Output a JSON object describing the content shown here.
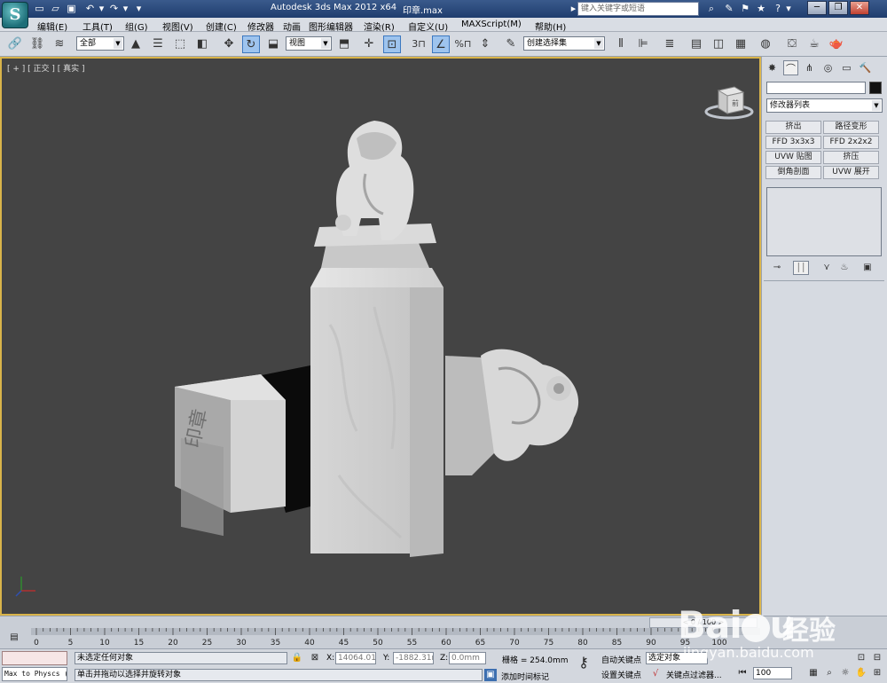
{
  "titlebar": {
    "logo": "S",
    "app_title": "Autodesk 3ds Max  2012 x64",
    "file_name": "印章.max",
    "search_placeholder": "键入关键字或短语",
    "window_buttons": [
      "─",
      "❐",
      "✕"
    ]
  },
  "menu": [
    "编辑(E)",
    "工具(T)",
    "组(G)",
    "视图(V)",
    "创建(C)",
    "修改器",
    "动画",
    "图形编辑器",
    "渲染(R)",
    "自定义(U)",
    "MAXScript(M)",
    "帮助(H)"
  ],
  "toolbar": {
    "selection_filter": "全部",
    "reference_coord": "视图",
    "named_selection": "创建选择集",
    "snap_label": "3",
    "percent_label": "%"
  },
  "viewport": {
    "label": "[ + ] [ 正交 ] [ 真实 ]",
    "viewcube_face": "前",
    "seal_text": "印章"
  },
  "command_panel": {
    "modifier_list": "修改器列表",
    "modifier_buttons": [
      "挤出",
      "路径变形",
      "FFD 3x3x3",
      "FFD 2x2x2",
      "UVW 贴图",
      "挤压",
      "倒角剖面",
      "UVW 展开"
    ]
  },
  "timeline": {
    "slider": "<   0 / 100   >",
    "ticks": [
      "0",
      "5",
      "10",
      "15",
      "20",
      "25",
      "30",
      "35",
      "40",
      "45",
      "50",
      "55",
      "60",
      "65",
      "70",
      "75",
      "80",
      "85",
      "90",
      "95",
      "100"
    ]
  },
  "status": {
    "maxscript_listener": "Max to Physcs (",
    "selection_status": "未选定任何对象",
    "prompt": "单击并拖动以选择并旋转对象",
    "x_label": "X:",
    "x_value": "14064.016",
    "y_label": "Y:",
    "y_value": "-1882.31m",
    "z_label": "Z:",
    "z_value": "0.0mm",
    "grid": "栅格 = 254.0mm",
    "add_time_tag": "添加时间标记",
    "auto_key": "自动关键点",
    "set_key": "设置关键点",
    "selected_object": "选定对象",
    "key_filters": "关键点过滤器...",
    "frame_value": "100"
  },
  "watermark": {
    "brand": "Bai",
    "brand_end": "u",
    "cn": "经验",
    "url": "jingyan.baidu.com"
  }
}
